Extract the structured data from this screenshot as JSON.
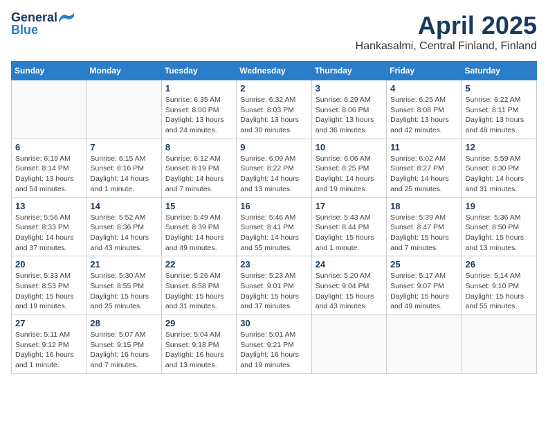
{
  "header": {
    "logo_line1": "General",
    "logo_line2": "Blue",
    "month_title": "April 2025",
    "location": "Hankasalmi, Central Finland, Finland"
  },
  "weekdays": [
    "Sunday",
    "Monday",
    "Tuesday",
    "Wednesday",
    "Thursday",
    "Friday",
    "Saturday"
  ],
  "weeks": [
    [
      {
        "day": "",
        "info": ""
      },
      {
        "day": "",
        "info": ""
      },
      {
        "day": "1",
        "info": "Sunrise: 6:35 AM\nSunset: 8:00 PM\nDaylight: 13 hours and 24 minutes."
      },
      {
        "day": "2",
        "info": "Sunrise: 6:32 AM\nSunset: 8:03 PM\nDaylight: 13 hours and 30 minutes."
      },
      {
        "day": "3",
        "info": "Sunrise: 6:29 AM\nSunset: 8:06 PM\nDaylight: 13 hours and 36 minutes."
      },
      {
        "day": "4",
        "info": "Sunrise: 6:25 AM\nSunset: 8:08 PM\nDaylight: 13 hours and 42 minutes."
      },
      {
        "day": "5",
        "info": "Sunrise: 6:22 AM\nSunset: 8:11 PM\nDaylight: 13 hours and 48 minutes."
      }
    ],
    [
      {
        "day": "6",
        "info": "Sunrise: 6:19 AM\nSunset: 8:14 PM\nDaylight: 13 hours and 54 minutes."
      },
      {
        "day": "7",
        "info": "Sunrise: 6:15 AM\nSunset: 8:16 PM\nDaylight: 14 hours and 1 minute."
      },
      {
        "day": "8",
        "info": "Sunrise: 6:12 AM\nSunset: 8:19 PM\nDaylight: 14 hours and 7 minutes."
      },
      {
        "day": "9",
        "info": "Sunrise: 6:09 AM\nSunset: 8:22 PM\nDaylight: 14 hours and 13 minutes."
      },
      {
        "day": "10",
        "info": "Sunrise: 6:06 AM\nSunset: 8:25 PM\nDaylight: 14 hours and 19 minutes."
      },
      {
        "day": "11",
        "info": "Sunrise: 6:02 AM\nSunset: 8:27 PM\nDaylight: 14 hours and 25 minutes."
      },
      {
        "day": "12",
        "info": "Sunrise: 5:59 AM\nSunset: 8:30 PM\nDaylight: 14 hours and 31 minutes."
      }
    ],
    [
      {
        "day": "13",
        "info": "Sunrise: 5:56 AM\nSunset: 8:33 PM\nDaylight: 14 hours and 37 minutes."
      },
      {
        "day": "14",
        "info": "Sunrise: 5:52 AM\nSunset: 8:36 PM\nDaylight: 14 hours and 43 minutes."
      },
      {
        "day": "15",
        "info": "Sunrise: 5:49 AM\nSunset: 8:39 PM\nDaylight: 14 hours and 49 minutes."
      },
      {
        "day": "16",
        "info": "Sunrise: 5:46 AM\nSunset: 8:41 PM\nDaylight: 14 hours and 55 minutes."
      },
      {
        "day": "17",
        "info": "Sunrise: 5:43 AM\nSunset: 8:44 PM\nDaylight: 15 hours and 1 minute."
      },
      {
        "day": "18",
        "info": "Sunrise: 5:39 AM\nSunset: 8:47 PM\nDaylight: 15 hours and 7 minutes."
      },
      {
        "day": "19",
        "info": "Sunrise: 5:36 AM\nSunset: 8:50 PM\nDaylight: 15 hours and 13 minutes."
      }
    ],
    [
      {
        "day": "20",
        "info": "Sunrise: 5:33 AM\nSunset: 8:53 PM\nDaylight: 15 hours and 19 minutes."
      },
      {
        "day": "21",
        "info": "Sunrise: 5:30 AM\nSunset: 8:55 PM\nDaylight: 15 hours and 25 minutes."
      },
      {
        "day": "22",
        "info": "Sunrise: 5:26 AM\nSunset: 8:58 PM\nDaylight: 15 hours and 31 minutes."
      },
      {
        "day": "23",
        "info": "Sunrise: 5:23 AM\nSunset: 9:01 PM\nDaylight: 15 hours and 37 minutes."
      },
      {
        "day": "24",
        "info": "Sunrise: 5:20 AM\nSunset: 9:04 PM\nDaylight: 15 hours and 43 minutes."
      },
      {
        "day": "25",
        "info": "Sunrise: 5:17 AM\nSunset: 9:07 PM\nDaylight: 15 hours and 49 minutes."
      },
      {
        "day": "26",
        "info": "Sunrise: 5:14 AM\nSunset: 9:10 PM\nDaylight: 15 hours and 55 minutes."
      }
    ],
    [
      {
        "day": "27",
        "info": "Sunrise: 5:11 AM\nSunset: 9:12 PM\nDaylight: 16 hours and 1 minute."
      },
      {
        "day": "28",
        "info": "Sunrise: 5:07 AM\nSunset: 9:15 PM\nDaylight: 16 hours and 7 minutes."
      },
      {
        "day": "29",
        "info": "Sunrise: 5:04 AM\nSunset: 9:18 PM\nDaylight: 16 hours and 13 minutes."
      },
      {
        "day": "30",
        "info": "Sunrise: 5:01 AM\nSunset: 9:21 PM\nDaylight: 16 hours and 19 minutes."
      },
      {
        "day": "",
        "info": ""
      },
      {
        "day": "",
        "info": ""
      },
      {
        "day": "",
        "info": ""
      }
    ]
  ]
}
